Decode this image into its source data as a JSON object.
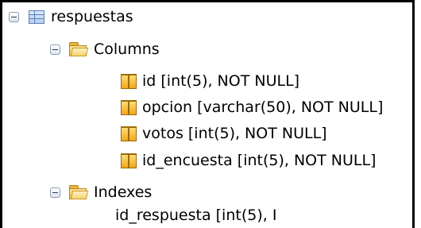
{
  "tree": {
    "table": {
      "label": "respuestas",
      "icon": "table-icon",
      "expanded": true
    },
    "columns_folder": {
      "label": "Columns",
      "icon": "folder-icon",
      "expanded": true
    },
    "columns": [
      {
        "label": "id [int(5), NOT NULL]",
        "icon": "column-icon"
      },
      {
        "label": "opcion [varchar(50), NOT NULL]",
        "icon": "column-icon"
      },
      {
        "label": "votos [int(5), NOT NULL]",
        "icon": "column-icon"
      },
      {
        "label": "id_encuesta [int(5), NOT NULL]",
        "icon": "column-icon"
      }
    ],
    "indexes_folder": {
      "label": "Indexes",
      "icon": "folder-icon",
      "expanded": true
    },
    "indexes": [
      {
        "label": "id_respuesta [int(5), I"
      }
    ]
  }
}
